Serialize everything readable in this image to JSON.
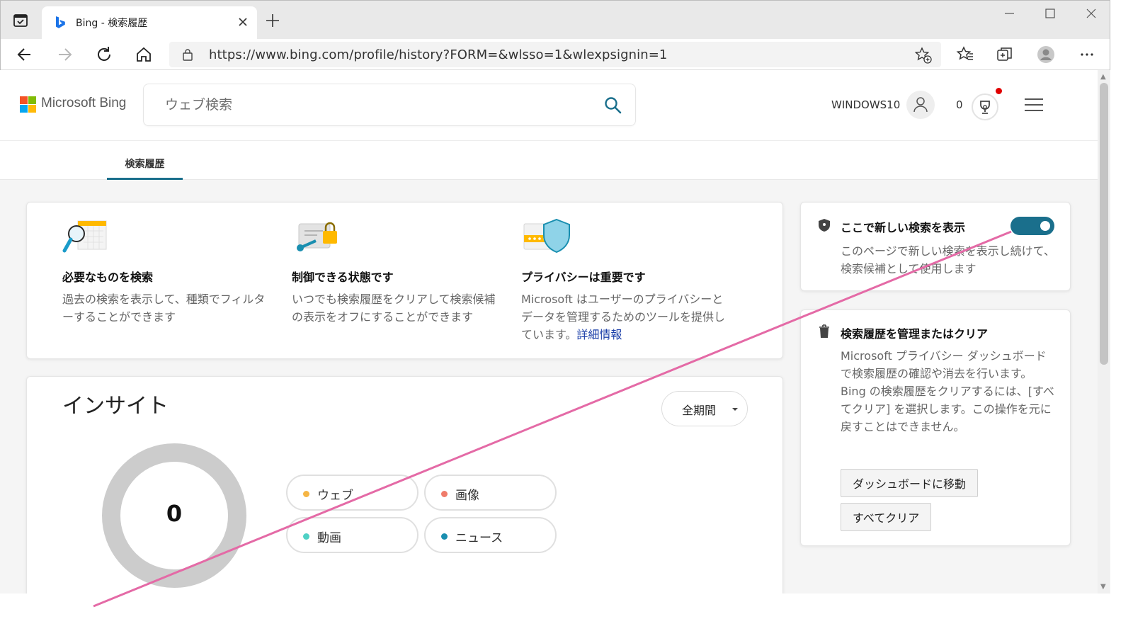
{
  "browser": {
    "tab_title": "Bing - 検索履歴",
    "url": "https://www.bing.com/profile/history?FORM=&wlsso=1&wlexpsignin=1"
  },
  "header": {
    "brand": "Microsoft Bing",
    "search_placeholder": "ウェブ検索",
    "user_name": "WINDOWS10",
    "points": "0"
  },
  "subnav": {
    "active_tab": "検索履歴"
  },
  "features": [
    {
      "title": "必要なものを検索",
      "text": "過去の検索を表示して、種類でフィルターすることができます"
    },
    {
      "title": "制御できる状態です",
      "text": "いつでも検索履歴をクリアして検索候補の表示をオフにすることができます"
    },
    {
      "title": "プライバシーは重要です",
      "text": "Microsoft はユーザーのプライバシーとデータを管理するためのツールを提供しています。",
      "link": "詳細情報"
    }
  ],
  "insights": {
    "title": "インサイト",
    "period": "全期間",
    "total": "0",
    "filters": [
      {
        "label": "ウェブ",
        "color": "#f5b544"
      },
      {
        "label": "画像",
        "color": "#ef7b6a"
      },
      {
        "label": "動画",
        "color": "#4fd1c5"
      },
      {
        "label": "ニュース",
        "color": "#1a8fb0"
      }
    ]
  },
  "side": {
    "show_search": {
      "title": "ここで新しい検索を表示",
      "text": "このページで新しい検索を表示し続けて、検索候補として使用します",
      "enabled": true
    },
    "manage": {
      "title": "検索履歴を管理またはクリア",
      "text": "Microsoft プライバシー ダッシュボードで検索履歴の確認や消去を行います。Bing の検索履歴をクリアするには、[すべてクリア] を選択します。この操作を元に戻すことはできません。",
      "dashboard_button": "ダッシュボードに移動",
      "clear_button": "すべてクリア"
    }
  },
  "colors": {
    "accent": "#1a6f8c",
    "annotation_line": "#e46aa6",
    "donut": "#cccccc"
  }
}
